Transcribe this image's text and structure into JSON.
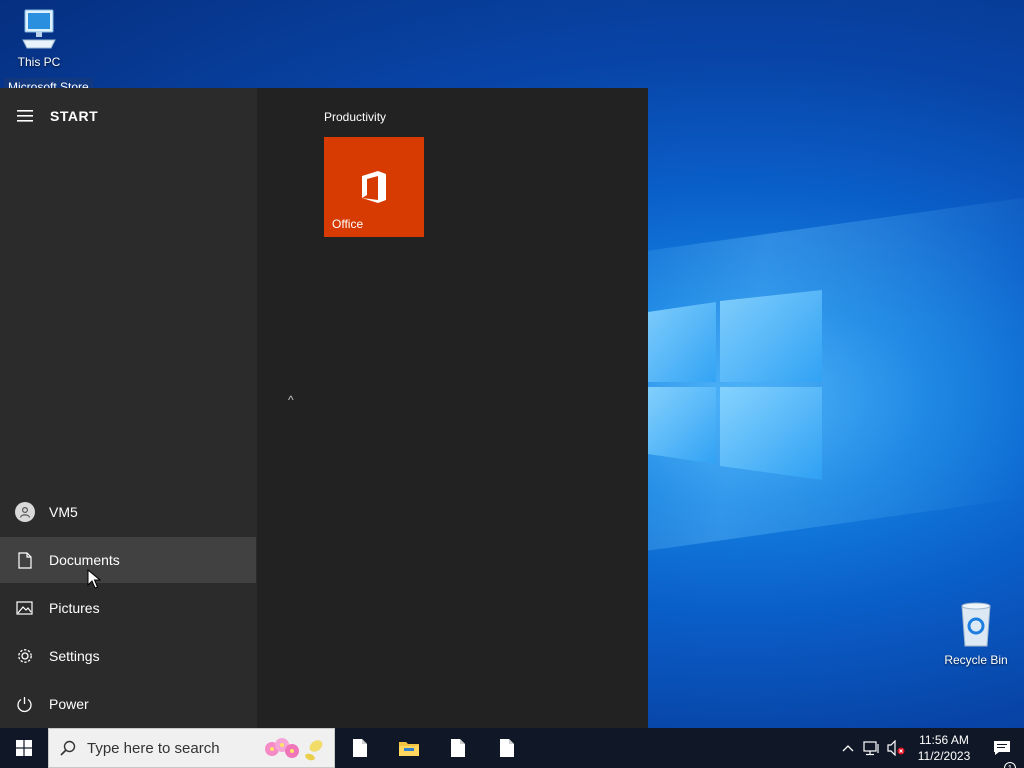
{
  "desktop": {
    "icons": [
      {
        "label": "This PC"
      },
      {
        "label": "Recycle Bin"
      }
    ],
    "tooltip": "Microsoft Store"
  },
  "start_menu": {
    "title": "START",
    "user": "VM5",
    "items": [
      {
        "label": "Documents",
        "icon": "document-icon"
      },
      {
        "label": "Pictures",
        "icon": "pictures-icon"
      },
      {
        "label": "Settings",
        "icon": "gear-icon"
      },
      {
        "label": "Power",
        "icon": "power-icon"
      }
    ],
    "group_title": "Productivity",
    "tiles": [
      {
        "label": "Office",
        "color": "#d83b01"
      }
    ]
  },
  "taskbar": {
    "search_placeholder": "Type here to search",
    "clock_time": "11:56 AM",
    "clock_date": "11/2/2023",
    "notification_count": "1"
  },
  "colors": {
    "start_left_bg": "#2b2b2b",
    "start_right_bg": "#222222",
    "accent_office": "#d83b01",
    "taskbar_bg": "#101827"
  }
}
